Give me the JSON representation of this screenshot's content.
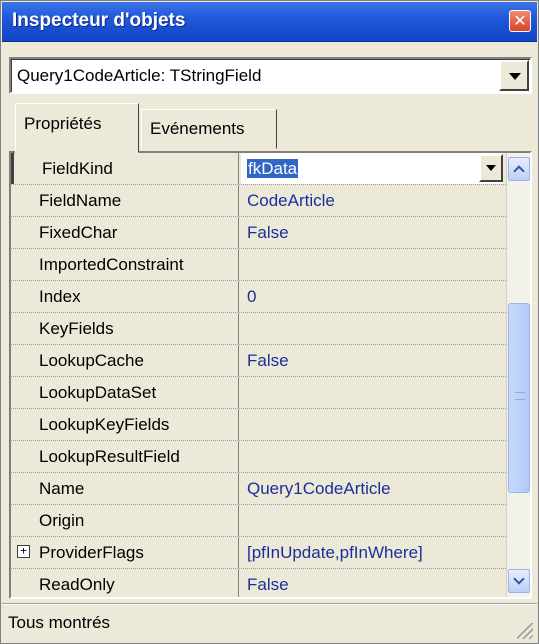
{
  "window": {
    "title": "Inspecteur d'objets",
    "close_glyph": "✕"
  },
  "object_selector": {
    "value": "Query1CodeArticle: TStringField"
  },
  "tabs": [
    {
      "label": "Propriétés",
      "active": true
    },
    {
      "label": "Evénements",
      "active": false
    }
  ],
  "properties": [
    {
      "name": "FieldKind",
      "value": "fkData",
      "selected": true,
      "has_dropdown": true
    },
    {
      "name": "FieldName",
      "value": "CodeArticle"
    },
    {
      "name": "FixedChar",
      "value": "False"
    },
    {
      "name": "ImportedConstraint",
      "value": ""
    },
    {
      "name": "Index",
      "value": "0"
    },
    {
      "name": "KeyFields",
      "value": ""
    },
    {
      "name": "LookupCache",
      "value": "False"
    },
    {
      "name": "LookupDataSet",
      "value": ""
    },
    {
      "name": "LookupKeyFields",
      "value": ""
    },
    {
      "name": "LookupResultField",
      "value": ""
    },
    {
      "name": "Name",
      "value": "Query1CodeArticle"
    },
    {
      "name": "Origin",
      "value": ""
    },
    {
      "name": "ProviderFlags",
      "value": "[pfInUpdate,pfInWhere]",
      "expandable": true,
      "expand_glyph": "+"
    },
    {
      "name": "ReadOnly",
      "value": "False"
    }
  ],
  "statusbar": {
    "text": "Tous montrés"
  },
  "colors": {
    "title_bar": "#1f55d8",
    "value_text": "#1d2e9a",
    "selection": "#3166c6"
  }
}
